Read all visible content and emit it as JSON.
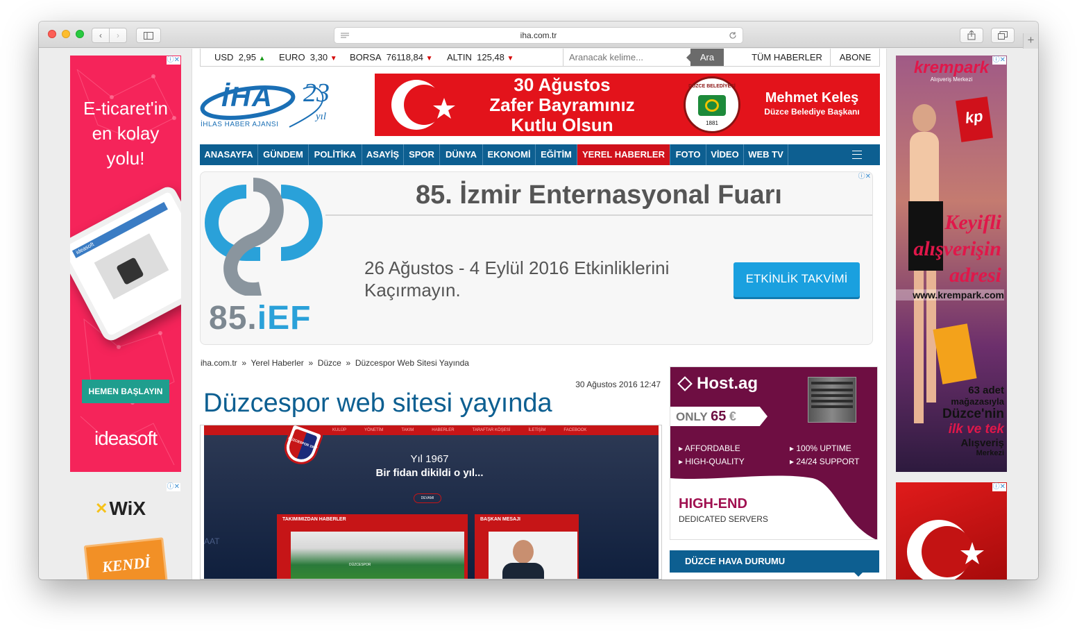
{
  "browser": {
    "url": "iha.com.tr"
  },
  "ticker": [
    {
      "label": "USD",
      "value": "2,95",
      "trend": "up"
    },
    {
      "label": "EURO",
      "value": "3,30",
      "trend": "down"
    },
    {
      "label": "BORSA",
      "value": "76118,84",
      "trend": "down"
    },
    {
      "label": "ALTIN",
      "value": "125,48",
      "trend": "down"
    }
  ],
  "search": {
    "placeholder": "Aranacak kelime...",
    "button": "Ara"
  },
  "top_links": {
    "all_news": "TÜM HABERLER",
    "subscribe": "ABONE"
  },
  "logo": {
    "text": "İHA",
    "years": "23",
    "years_word": "yıl",
    "subtitle": "İHLAS HABER AJANSI"
  },
  "header_banner": {
    "line1": "30 Ağustos",
    "line2": "Zafer Bayramınız",
    "line3": "Kutlu Olsun",
    "seal_text": "DÜZCE BELEDİYESİ",
    "seal_year": "1881",
    "name": "Mehmet Keleş",
    "role": "Düzce Belediye Başkanı"
  },
  "nav": {
    "items": [
      "ANASAYFA",
      "GÜNDEM",
      "POLİTİKA",
      "ASAYİŞ",
      "SPOR",
      "DÜNYA",
      "EKONOMİ",
      "EĞİTİM",
      "YEREL HABERLER",
      "FOTO",
      "VİDEO",
      "WEB TV"
    ],
    "active_index": 8
  },
  "izmir_ad": {
    "title": "85. İzmir Enternasyonal Fuarı",
    "text": "26 Ağustos - 4 Eylül 2016 Etkinliklerini Kaçırmayın.",
    "button": "ETKİNLİK TAKVİMİ",
    "logo_num": "85.",
    "logo_ief": "iEF"
  },
  "breadcrumb": [
    "iha.com.tr",
    "Yerel Haberler",
    "Düzce",
    "Düzcespor Web Sitesi Yayında"
  ],
  "article": {
    "date": "30 Ağustos 2016 12:47",
    "title": "Düzcespor web sitesi yayında",
    "image": {
      "menu": [
        "KULÜP",
        "YÖNETİM",
        "TAKIM",
        "HABERLER",
        "TARAFTAR KÖŞESİ",
        "İLETİŞİM",
        "FACEBOOK"
      ],
      "crest": "DÜZCESPOR 1967",
      "hero_year": "Yıl 1967",
      "hero_text": "Bir fidan dikildi o yıl...",
      "hero_button": "DEVAMI",
      "panel_left": "TAKIMIMIZDAN HABERLER",
      "panel_right": "BAŞKAN MESAJI",
      "side_text": "AAT",
      "jersey": "DÜZCESPOR"
    }
  },
  "left_ad": {
    "headline": "E-ticaret'in en kolay yolu!",
    "button": "HEMEN BAŞLAYIN",
    "brand": "ideasoft",
    "tablet_label": "ideasoft"
  },
  "wix_ad": {
    "brand": "WiX",
    "text": "KENDİ"
  },
  "host_ad": {
    "brand": "Host.ag",
    "price_prefix": "ONLY",
    "price": "65",
    "currency": "€",
    "features": [
      "AFFORDABLE",
      "100% UPTIME",
      "HIGH-QUALITY",
      "24/24 SUPPORT"
    ],
    "headline": "HIGH-END",
    "subhead": "DEDICATED SERVERS"
  },
  "weather": {
    "title": "DÜZCE HAVA DURUMU"
  },
  "krempark_ad": {
    "brand": "krempark",
    "sub": "Alışveriş Merkezi",
    "bag": "kp",
    "slogan1": "Keyifli",
    "slogan2": "alışverişin",
    "slogan3": "adresi",
    "url": "www.krempark.com",
    "stores": "63 adet",
    "stores2": "mağazasıyla",
    "city": "Düzce'nin",
    "first": "ilk ve tek",
    "shop": "Alışveriş",
    "center": "Merkezi"
  },
  "ad_marker": "ⓘ✕",
  "colors": {
    "nav": "#0d5f91",
    "active": "#d0111b",
    "title": "#0d5f91",
    "ad_pink": "#f5245a",
    "host": "#6e0e42"
  }
}
